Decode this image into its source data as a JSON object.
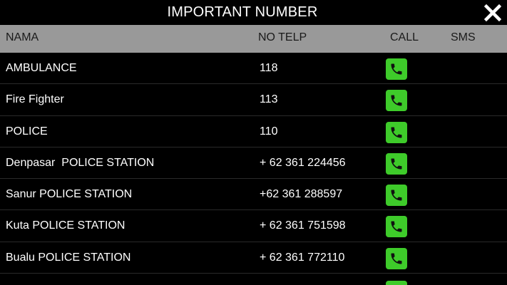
{
  "title": "IMPORTANT NUMBER",
  "colors": {
    "background": "#000000",
    "header_bg": "#999999",
    "call_button": "#3ecb2a",
    "text": "#ffffff"
  },
  "columns": {
    "name": "NAMA",
    "phone": "NO TELP",
    "call": "CALL",
    "sms": "SMS"
  },
  "contacts": [
    {
      "name": "AMBULANCE",
      "phone": "118",
      "call_icon": "phone-icon"
    },
    {
      "name": "Fire Fighter",
      "phone": "113",
      "call_icon": "phone-icon"
    },
    {
      "name": "POLICE",
      "phone": "110",
      "call_icon": "phone-icon"
    },
    {
      "name": "Denpasar  POLICE STATION",
      "phone": "+ 62 361 224456",
      "call_icon": "phone-icon"
    },
    {
      "name": "Sanur POLICE STATION",
      "phone": "+62 361 288597",
      "call_icon": "phone-icon"
    },
    {
      "name": "Kuta POLICE STATION",
      "phone": "+ 62 361 751598",
      "call_icon": "phone-icon"
    },
    {
      "name": "Bualu POLICE STATION",
      "phone": "+ 62 361 772110",
      "call_icon": "phone-icon"
    }
  ],
  "close_icon": "close-icon"
}
